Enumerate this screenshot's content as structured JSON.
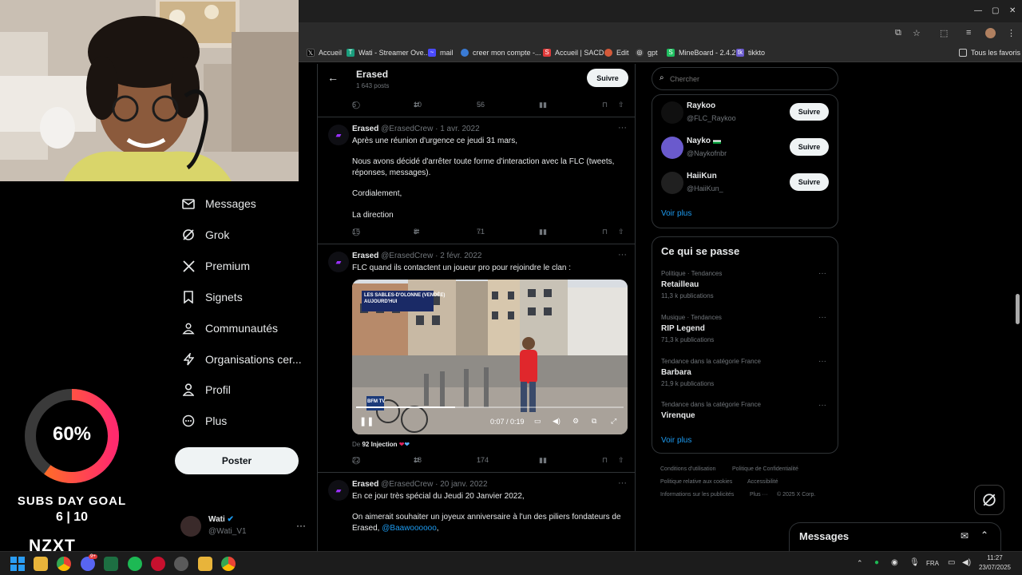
{
  "bookmarks": [
    {
      "label": "Accueil",
      "icon": "x-logo-icon",
      "color": "#000000"
    },
    {
      "label": "Wati - Streamer Ove...",
      "icon": "t-icon",
      "color": "#1a9e7d"
    },
    {
      "label": "mail",
      "icon": "mail-icon",
      "color": "#4a4aff"
    },
    {
      "label": "creer mon compte -...",
      "icon": "cloud-icon",
      "color": "#3a7bd5"
    },
    {
      "label": "Accueil | SACD",
      "icon": "s-icon",
      "color": "#e03a3a"
    },
    {
      "label": "Edit",
      "icon": "edit-icon",
      "color": "#d45a3a"
    },
    {
      "label": "gpt",
      "icon": "openai-icon",
      "color": "#888888"
    },
    {
      "label": "MineBoard - 2.4.2",
      "icon": "s-icon",
      "color": "#1fbf60"
    },
    {
      "label": "tikkto",
      "icon": "tk-icon",
      "color": "#6a5acd"
    }
  ],
  "bookmarks_all": "Tous les favoris",
  "overlay": {
    "progress_text": "60%",
    "progress_value": 0.6,
    "goal_title": "SUBS DAY GOAL",
    "goal_value": "6 | 10",
    "brand": "NZXT"
  },
  "nav": [
    {
      "label": "Messages",
      "icon": "envelope-icon"
    },
    {
      "label": "Grok",
      "icon": "grok-icon"
    },
    {
      "label": "Premium",
      "icon": "x-icon"
    },
    {
      "label": "Signets",
      "icon": "bookmark-icon"
    },
    {
      "label": "Communautés",
      "icon": "people-icon"
    },
    {
      "label": "Organisations cer...",
      "icon": "bolt-icon"
    },
    {
      "label": "Profil",
      "icon": "person-icon"
    },
    {
      "label": "Plus",
      "icon": "more-circle-icon"
    }
  ],
  "poster_label": "Poster",
  "account": {
    "name": "Wati",
    "handle": "@Wati_V1"
  },
  "profile_header": {
    "name": "Erased",
    "posts": "1 643 posts",
    "follow_label": "Suivre"
  },
  "top_actions": {
    "replies": "6",
    "reposts": "10",
    "likes": "56"
  },
  "tweets": [
    {
      "author": "Erased",
      "handle": "@ErasedCrew",
      "date": "· 1 avr. 2022",
      "lines": [
        "Après une réunion d'urgence ce jeudi 31 mars,",
        "",
        "Nous avons décidé d'arrêter toute forme d'interaction avec la FLC (tweets, réponses, messages).",
        "",
        "Cordialement,",
        "",
        "La direction"
      ],
      "replies": "15",
      "reposts": "8",
      "likes": "71"
    },
    {
      "author": "Erased",
      "handle": "@ErasedCrew",
      "date": "· 2 févr. 2022",
      "lines": [
        "FLC quand ils contactent un joueur pro pour rejoindre le clan :"
      ],
      "video": {
        "banner": "LES SABLES-D'OLONNE (VENDÉE)",
        "banner2": "AUJOURD'HUI",
        "channel": "BFM TV",
        "time": "0:07 / 0:19",
        "progress": 0.37
      },
      "from_prefix": "De",
      "from_name": "92 Injection",
      "replies": "22",
      "reposts": "18",
      "likes": "174"
    },
    {
      "author": "Erased",
      "handle": "@ErasedCrew",
      "date": "· 20 janv. 2022",
      "lines": [
        "En ce jour très spécial du Jeudi 20 Janvier 2022,",
        "",
        "On aimerait souhaiter un joyeux anniversaire à l'un des piliers fondateurs de"
      ],
      "line_mention_prefix": "Erased,",
      "mention": "@Baawoooooo",
      "mention_suffix": ","
    }
  ],
  "search": {
    "placeholder": "Chercher"
  },
  "follow_suggestions": [
    {
      "name": "Raykoo",
      "handle": "@FLC_Raykoo",
      "button": "Suivre"
    },
    {
      "name": "Nayko",
      "handle": "@Naykofnbr",
      "button": "Suivre"
    },
    {
      "name": "HaiiKun",
      "handle": "@HaiiKun_",
      "button": "Suivre"
    }
  ],
  "voir_plus": "Voir plus",
  "trends_title": "Ce qui se passe",
  "trends": [
    {
      "category": "Politique · Tendances",
      "name": "Retailleau",
      "count": "11,3 k publications"
    },
    {
      "category": "Musique · Tendances",
      "name": "RIP Legend",
      "count": "71,3 k publications"
    },
    {
      "category": "Tendance dans la catégorie France",
      "name": "Barbara",
      "count": "21,9 k publications"
    },
    {
      "category": "Tendance dans la catégorie France",
      "name": "Virenque",
      "count": ""
    }
  ],
  "footer": {
    "links": [
      "Conditions d'utilisation",
      "Politique de Confidentialité",
      "Politique relative aux cookies",
      "Accessibilité",
      "Informations sur les publicités",
      "Plus ···",
      "© 2025 X Corp."
    ]
  },
  "messages_dock": "Messages",
  "taskbar": {
    "lang": "FRA",
    "time": "11:27",
    "date": "23/07/2025",
    "discord_badge": "9+"
  },
  "colors": {
    "accent": "#1d9bf0",
    "ring_start": "#ff7a1a",
    "ring_end": "#ff2a6d"
  }
}
